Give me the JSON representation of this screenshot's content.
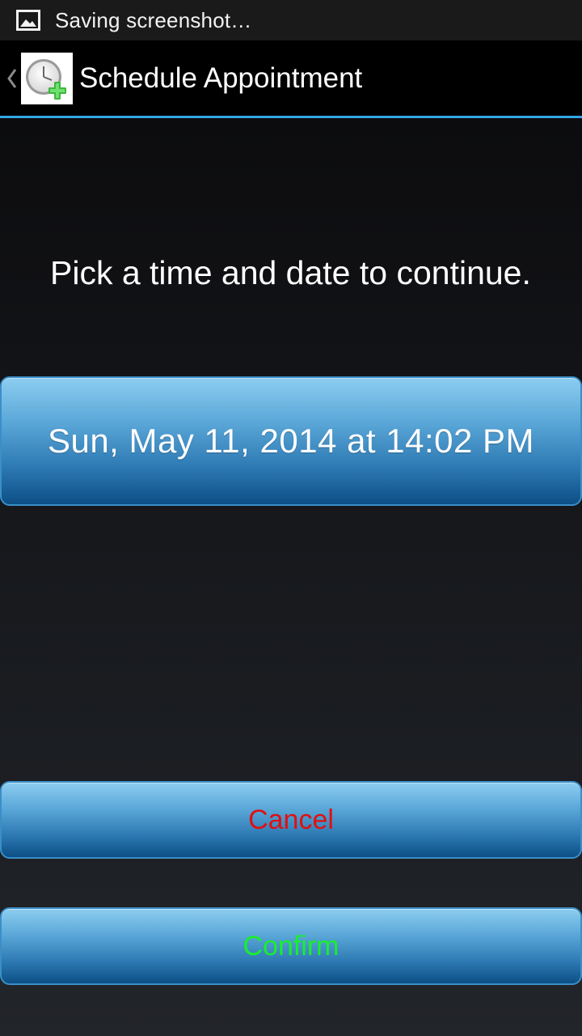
{
  "status_bar": {
    "notification_icon": "image-icon",
    "text": "Saving screenshot…"
  },
  "action_bar": {
    "up_icon": "chevron-left-icon",
    "app_icon": "clock-add-icon",
    "title": "Schedule Appointment",
    "divider_color": "#33a5e4"
  },
  "main": {
    "instruction": "Pick a time and date to continue.",
    "datetime_button": "Sun, May 11, 2014 at 14:02 PM",
    "cancel_button": "Cancel",
    "confirm_button": "Confirm"
  },
  "colors": {
    "cancel_text": "#e01010",
    "confirm_text": "#18f02a",
    "button_top": "#8ccdf0",
    "button_bottom": "#0c4f86"
  }
}
